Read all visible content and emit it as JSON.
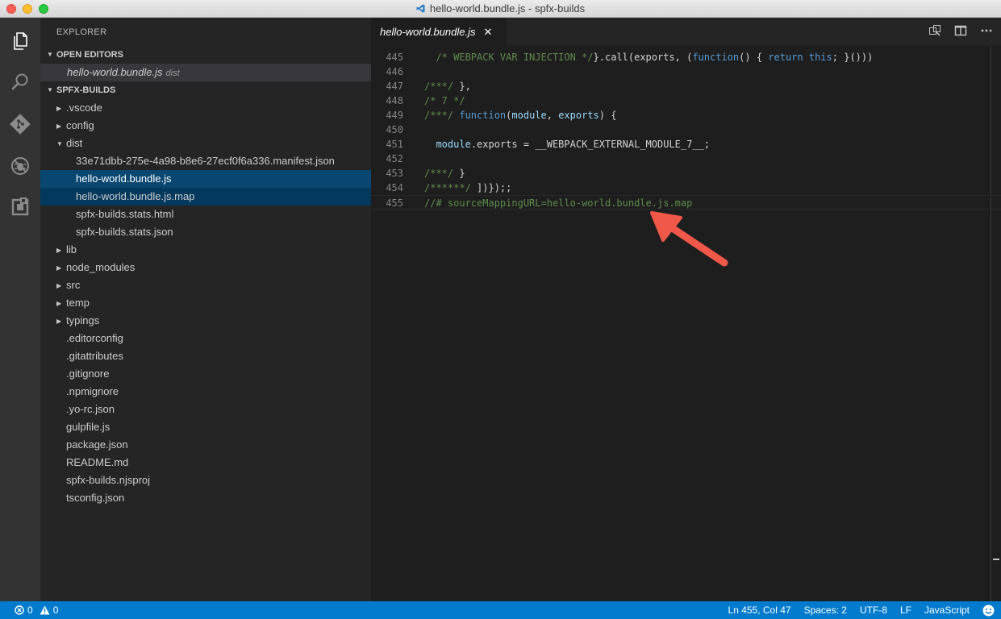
{
  "window": {
    "title": "hello-world.bundle.js - spfx-builds"
  },
  "activity_bar": {
    "items": [
      "explorer-icon",
      "search-icon",
      "git-icon",
      "debug-icon",
      "extensions-icon"
    ]
  },
  "sidebar": {
    "title": "EXPLORER",
    "open_editors_header": "OPEN EDITORS",
    "open_editor": {
      "name": "hello-world.bundle.js",
      "desc": "dist"
    },
    "project_header": "SPFX-BUILDS",
    "tree": [
      {
        "label": ".vscode",
        "type": "folder",
        "level": 0
      },
      {
        "label": "config",
        "type": "folder",
        "level": 0
      },
      {
        "label": "dist",
        "type": "folder-open",
        "level": 0
      },
      {
        "label": "33e71dbb-275e-4a98-b8e6-27ecf0f6a336.manifest.json",
        "type": "file",
        "level": 1
      },
      {
        "label": "hello-world.bundle.js",
        "type": "file",
        "level": 1
      },
      {
        "label": "hello-world.bundle.js.map",
        "type": "file",
        "level": 1
      },
      {
        "label": "spfx-builds.stats.html",
        "type": "file",
        "level": 1
      },
      {
        "label": "spfx-builds.stats.json",
        "type": "file",
        "level": 1
      },
      {
        "label": "lib",
        "type": "folder",
        "level": 0
      },
      {
        "label": "node_modules",
        "type": "folder",
        "level": 0
      },
      {
        "label": "src",
        "type": "folder",
        "level": 0
      },
      {
        "label": "temp",
        "type": "folder",
        "level": 0
      },
      {
        "label": "typings",
        "type": "folder",
        "level": 0
      },
      {
        "label": ".editorconfig",
        "type": "file",
        "level": 0
      },
      {
        "label": ".gitattributes",
        "type": "file",
        "level": 0
      },
      {
        "label": ".gitignore",
        "type": "file",
        "level": 0
      },
      {
        "label": ".npmignore",
        "type": "file",
        "level": 0
      },
      {
        "label": ".yo-rc.json",
        "type": "file",
        "level": 0
      },
      {
        "label": "gulpfile.js",
        "type": "file",
        "level": 0
      },
      {
        "label": "package.json",
        "type": "file",
        "level": 0
      },
      {
        "label": "README.md",
        "type": "file",
        "level": 0
      },
      {
        "label": "spfx-builds.njsproj",
        "type": "file",
        "level": 0
      },
      {
        "label": "tsconfig.json",
        "type": "file",
        "level": 0
      }
    ]
  },
  "editor": {
    "tab_label": "hello-world.bundle.js",
    "tab_close": "✕",
    "lines": [
      {
        "n": "445",
        "parts": [
          [
            "c",
            "  /* WEBPACK VAR INJECTION */"
          ],
          [
            "p",
            "}.call(exports, ("
          ],
          [
            "k",
            "function"
          ],
          [
            "p",
            "() { "
          ],
          [
            "k",
            "return"
          ],
          [
            "p",
            " "
          ],
          [
            "k",
            "this"
          ],
          [
            "p",
            "; }()))"
          ]
        ]
      },
      {
        "n": "446",
        "parts": []
      },
      {
        "n": "447",
        "parts": [
          [
            "c",
            "/***/"
          ],
          [
            "p",
            " },"
          ]
        ]
      },
      {
        "n": "448",
        "parts": [
          [
            "c",
            "/* 7 */"
          ]
        ]
      },
      {
        "n": "449",
        "parts": [
          [
            "c",
            "/***/"
          ],
          [
            "p",
            " "
          ],
          [
            "k",
            "function"
          ],
          [
            "p",
            "("
          ],
          [
            "v",
            "module"
          ],
          [
            "p",
            ", "
          ],
          [
            "v",
            "exports"
          ],
          [
            "p",
            ") {"
          ]
        ]
      },
      {
        "n": "450",
        "parts": []
      },
      {
        "n": "451",
        "parts": [
          [
            "p",
            "  "
          ],
          [
            "v",
            "module"
          ],
          [
            "p",
            ".exports = __WEBPACK_EXTERNAL_MODULE_7__;"
          ]
        ]
      },
      {
        "n": "452",
        "parts": []
      },
      {
        "n": "453",
        "parts": [
          [
            "c",
            "/***/"
          ],
          [
            "p",
            " }"
          ]
        ]
      },
      {
        "n": "454",
        "parts": [
          [
            "c",
            "/******/"
          ],
          [
            "p",
            " ])});;"
          ]
        ]
      },
      {
        "n": "455",
        "parts": [
          [
            "c",
            "//# sourceMappingURL=hello-world.bundle.js.map"
          ]
        ]
      }
    ],
    "current_line": "455"
  },
  "status_bar": {
    "errors": "0",
    "warnings": "0",
    "position": "Ln 455, Col 47",
    "spaces": "Spaces: 2",
    "encoding": "UTF-8",
    "eol": "LF",
    "language": "JavaScript",
    "feedback_icon": "smiley-icon"
  },
  "colors": {
    "accent": "#007acc",
    "annotation_arrow": "#f0584a",
    "selection": "#094771"
  }
}
